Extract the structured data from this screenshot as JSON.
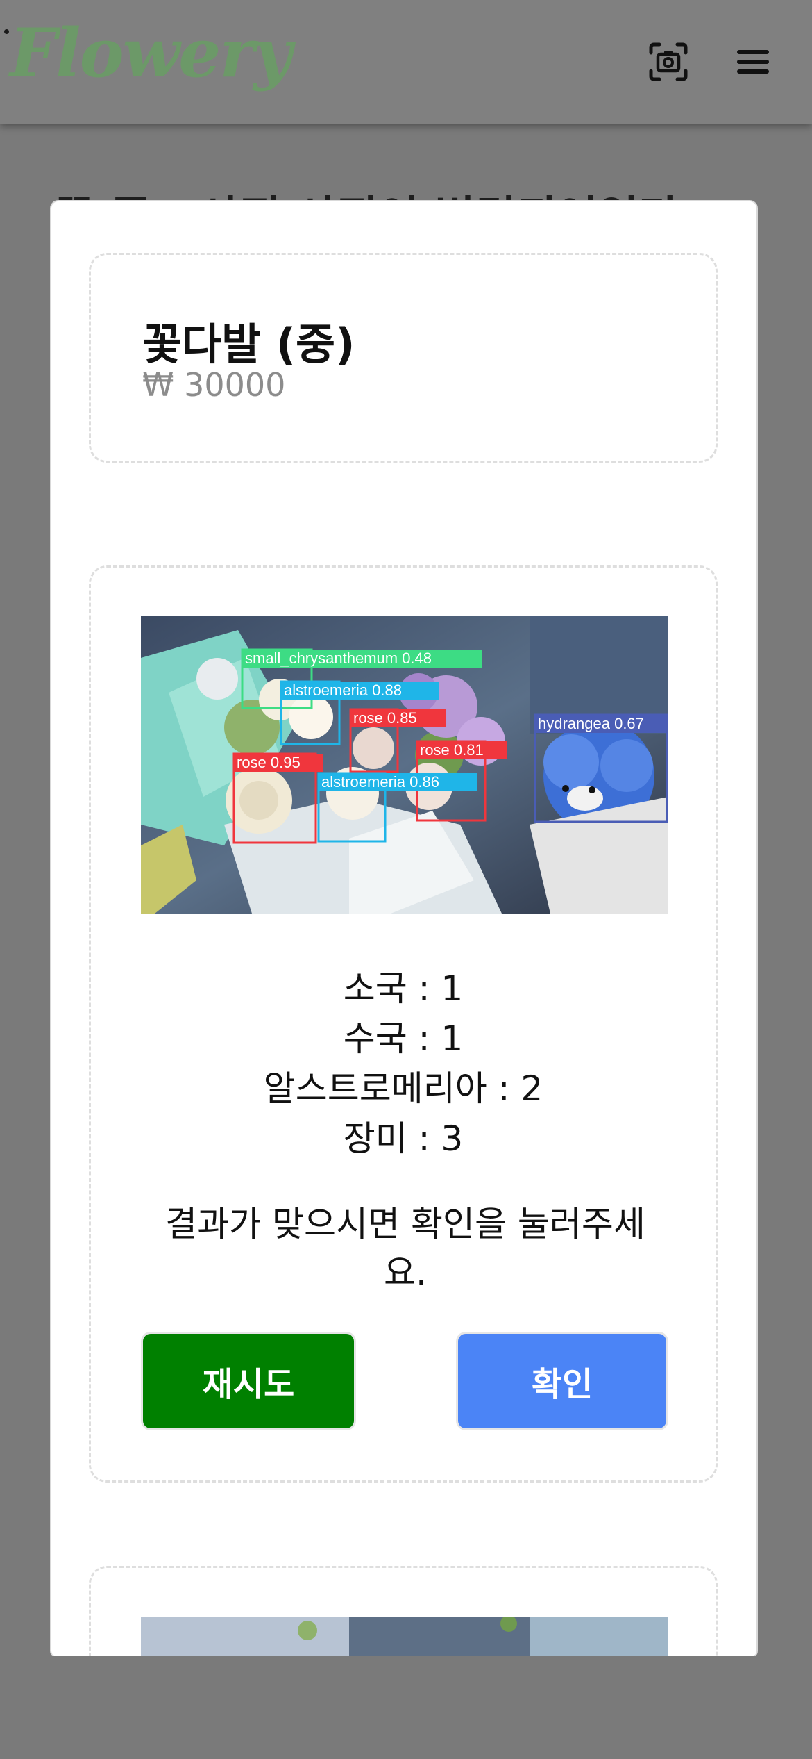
{
  "header": {
    "logo_text": "Flowery",
    "scan_icon": "camera-scan-icon",
    "menu_icon": "hamburger-menu-icon"
  },
  "background": {
    "title": "꽃 종 · 사진 사진이 변경되어있다"
  },
  "product": {
    "name": "꽃다발 (중)",
    "price": "₩ 30000"
  },
  "detection": {
    "boxes": [
      {
        "label": "small_chrysanthemum 0.48",
        "color": "#3ddc84"
      },
      {
        "label": "alstroemeria 0.88",
        "color": "#1fb5e8"
      },
      {
        "label": "rose 0.85",
        "color": "#f0363d"
      },
      {
        "label": "rose 0.81",
        "color": "#f0363d"
      },
      {
        "label": "hydrangea 0.67",
        "color": "#4a5db5"
      },
      {
        "label": "rose 0.95",
        "color": "#f0363d"
      },
      {
        "label": "alstroemeria 0.86",
        "color": "#1fb5e8"
      }
    ]
  },
  "counts": [
    "소국 : 1",
    "수국 : 1",
    "알스트로메리아 : 2",
    "장미 : 3"
  ],
  "message": "결과가 맞으시면 확인을 눌러주세요.",
  "buttons": {
    "retry": "재시도",
    "confirm": "확인"
  },
  "colors": {
    "retry_bg": "#008000",
    "confirm_bg": "#4b84f6",
    "logo": "#6c9968"
  }
}
